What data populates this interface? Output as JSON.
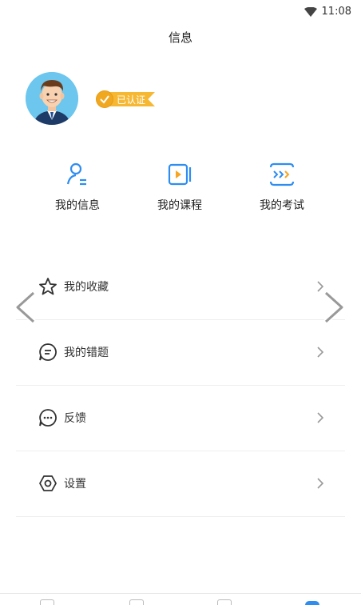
{
  "status_bar": {
    "time": "11:08"
  },
  "header": {
    "title": "信息"
  },
  "profile": {
    "badge_text": "已认证"
  },
  "quick_links": [
    {
      "label": "我的信息",
      "icon": "user-info-icon"
    },
    {
      "label": "我的课程",
      "icon": "video-course-icon"
    },
    {
      "label": "我的考试",
      "icon": "exam-icon"
    }
  ],
  "menu": [
    {
      "label": "我的收藏",
      "icon": "star-icon"
    },
    {
      "label": "我的错题",
      "icon": "chat-list-icon"
    },
    {
      "label": "反馈",
      "icon": "feedback-icon"
    },
    {
      "label": "设置",
      "icon": "settings-icon"
    }
  ],
  "colors": {
    "accent": "#2f8df0",
    "badge": "#f6b833",
    "avatar_bg": "#6cc6ee"
  }
}
